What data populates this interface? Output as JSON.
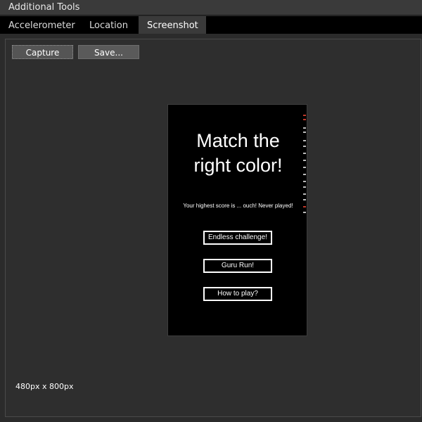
{
  "window": {
    "title": "Additional Tools"
  },
  "tabs": [
    {
      "label": "Accelerometer",
      "active": false
    },
    {
      "label": "Location",
      "active": false
    },
    {
      "label": "Screenshot",
      "active": true
    }
  ],
  "toolbar": {
    "capture_label": "Capture",
    "save_label": "Save..."
  },
  "preview": {
    "app_title_line1": "Match the",
    "app_title_line2": "right color!",
    "score_text": "Your highest score is ... ouch! Never played!",
    "buttons": [
      "Endless challenge!",
      "Guru Run!",
      "How to play?"
    ]
  },
  "resolution_text": "480px x 800px",
  "colors": {
    "background": "#2b2b2b",
    "preview_bg": "#000000",
    "button_bg": "#5a5a5a",
    "accent": "#c0392b"
  }
}
